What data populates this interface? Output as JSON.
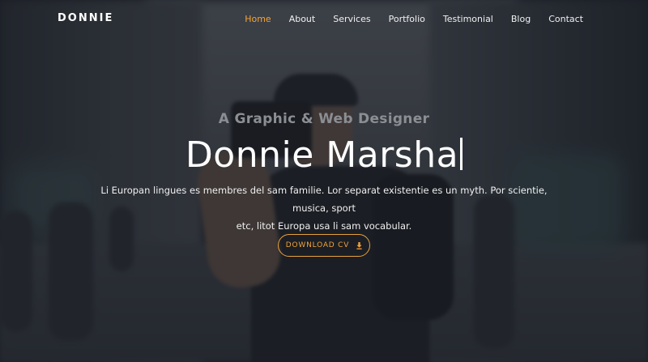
{
  "brand": "DONNIE",
  "nav": {
    "items": [
      {
        "label": "Home",
        "active": true
      },
      {
        "label": "About",
        "active": false
      },
      {
        "label": "Services",
        "active": false
      },
      {
        "label": "Portfolio",
        "active": false
      },
      {
        "label": "Testimonial",
        "active": false
      },
      {
        "label": "Blog",
        "active": false
      },
      {
        "label": "Contact",
        "active": false
      }
    ]
  },
  "hero": {
    "subtitle": "A Graphic & Web Designer",
    "title": "Donnie Marsha",
    "description_line1": "Li Europan lingues es membres del sam familie. Lor separat existentie es un myth. Por scientie, musica, sport",
    "description_line2": "etc, litot Europa usa li sam vocabular.",
    "button_label": "DOWNLOAD CV",
    "button_icon": "download-icon"
  },
  "colors": {
    "accent": "#f1a33b",
    "overlay": "#181b21",
    "text": "#ffffff"
  }
}
